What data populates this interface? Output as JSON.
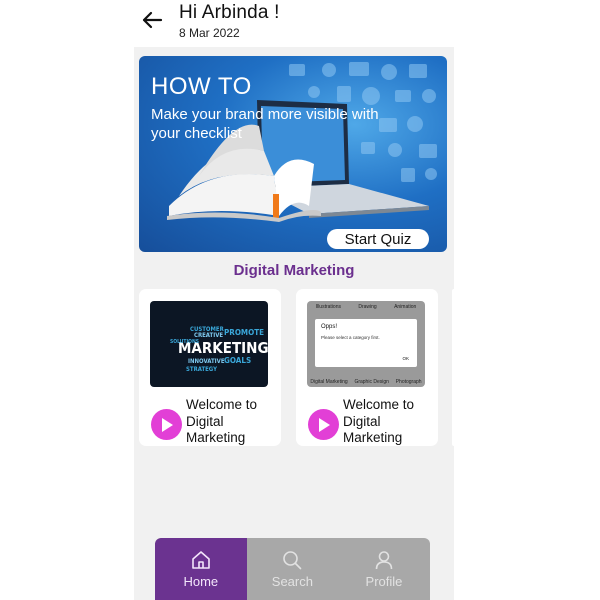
{
  "header": {
    "greeting": "Hi Arbinda !",
    "date": "8 Mar 2022",
    "back_icon": "arrow-left-icon"
  },
  "banner": {
    "title": "HOW TO",
    "subtitle": "Make your brand more visible with your checklist",
    "quiz_button": "Start Quiz",
    "colors": {
      "gradient_light": "#4fa8e8",
      "gradient_dark": "#164e9a"
    }
  },
  "section": {
    "title": "Digital Marketing"
  },
  "cards": [
    {
      "title": "Welcome to Digital Marketing",
      "thumbnail_word": "MARKETING",
      "thumbnail_words": [
        "CREATIVE",
        "PROMOTE",
        "GOALS",
        "CUSTOMER",
        "SOLUTIONS",
        "INNOVATIVE",
        "STRATEGY"
      ],
      "play_icon": "play-icon"
    },
    {
      "title": "Welcome to Digital Marketing",
      "thumbnail_tabs": [
        "Illustrations",
        "Drawing",
        "Animation"
      ],
      "thumbnail_bottom": [
        "Digital Marketing",
        "Graphic Design",
        "Photograph"
      ],
      "dialog_title": "Opps!",
      "dialog_message": "Please select a category first.",
      "dialog_button": "OK",
      "play_icon": "play-icon"
    }
  ],
  "bottom_nav": [
    {
      "label": "Home",
      "icon": "home-icon",
      "active": true
    },
    {
      "label": "Search",
      "icon": "search-icon",
      "active": false
    },
    {
      "label": "Profile",
      "icon": "user-icon",
      "active": false
    }
  ],
  "colors": {
    "accent": "#6b2f8e",
    "play": "#e23fd6",
    "nav_bg": "#a8a8a8"
  }
}
